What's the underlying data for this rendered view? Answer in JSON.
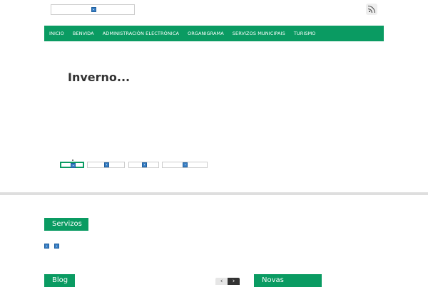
{
  "header": {
    "logo_icon": "broken-image-icon",
    "rss_icon": "rss-icon"
  },
  "nav": {
    "items": [
      {
        "label": "INICIO"
      },
      {
        "label": "BENVIDA"
      },
      {
        "label": "ADMINISTRACIÓN ELECTRÓNICA"
      },
      {
        "label": "ORGANIGRAMA"
      },
      {
        "label": "SERVIZOS MUNICIPAIS"
      },
      {
        "label": "TURISMO"
      }
    ]
  },
  "slider": {
    "title": "Inverno...",
    "thumbnails_icon": "broken-image-icon"
  },
  "servizos": {
    "title": "Servizos"
  },
  "blog": {
    "title": "Blog",
    "prev_glyph": "‹",
    "next_glyph": "›"
  },
  "novas": {
    "title": "Novas"
  },
  "colors": {
    "accent": "#0a9b62",
    "heading": "#333333",
    "divider": "#dedede"
  }
}
